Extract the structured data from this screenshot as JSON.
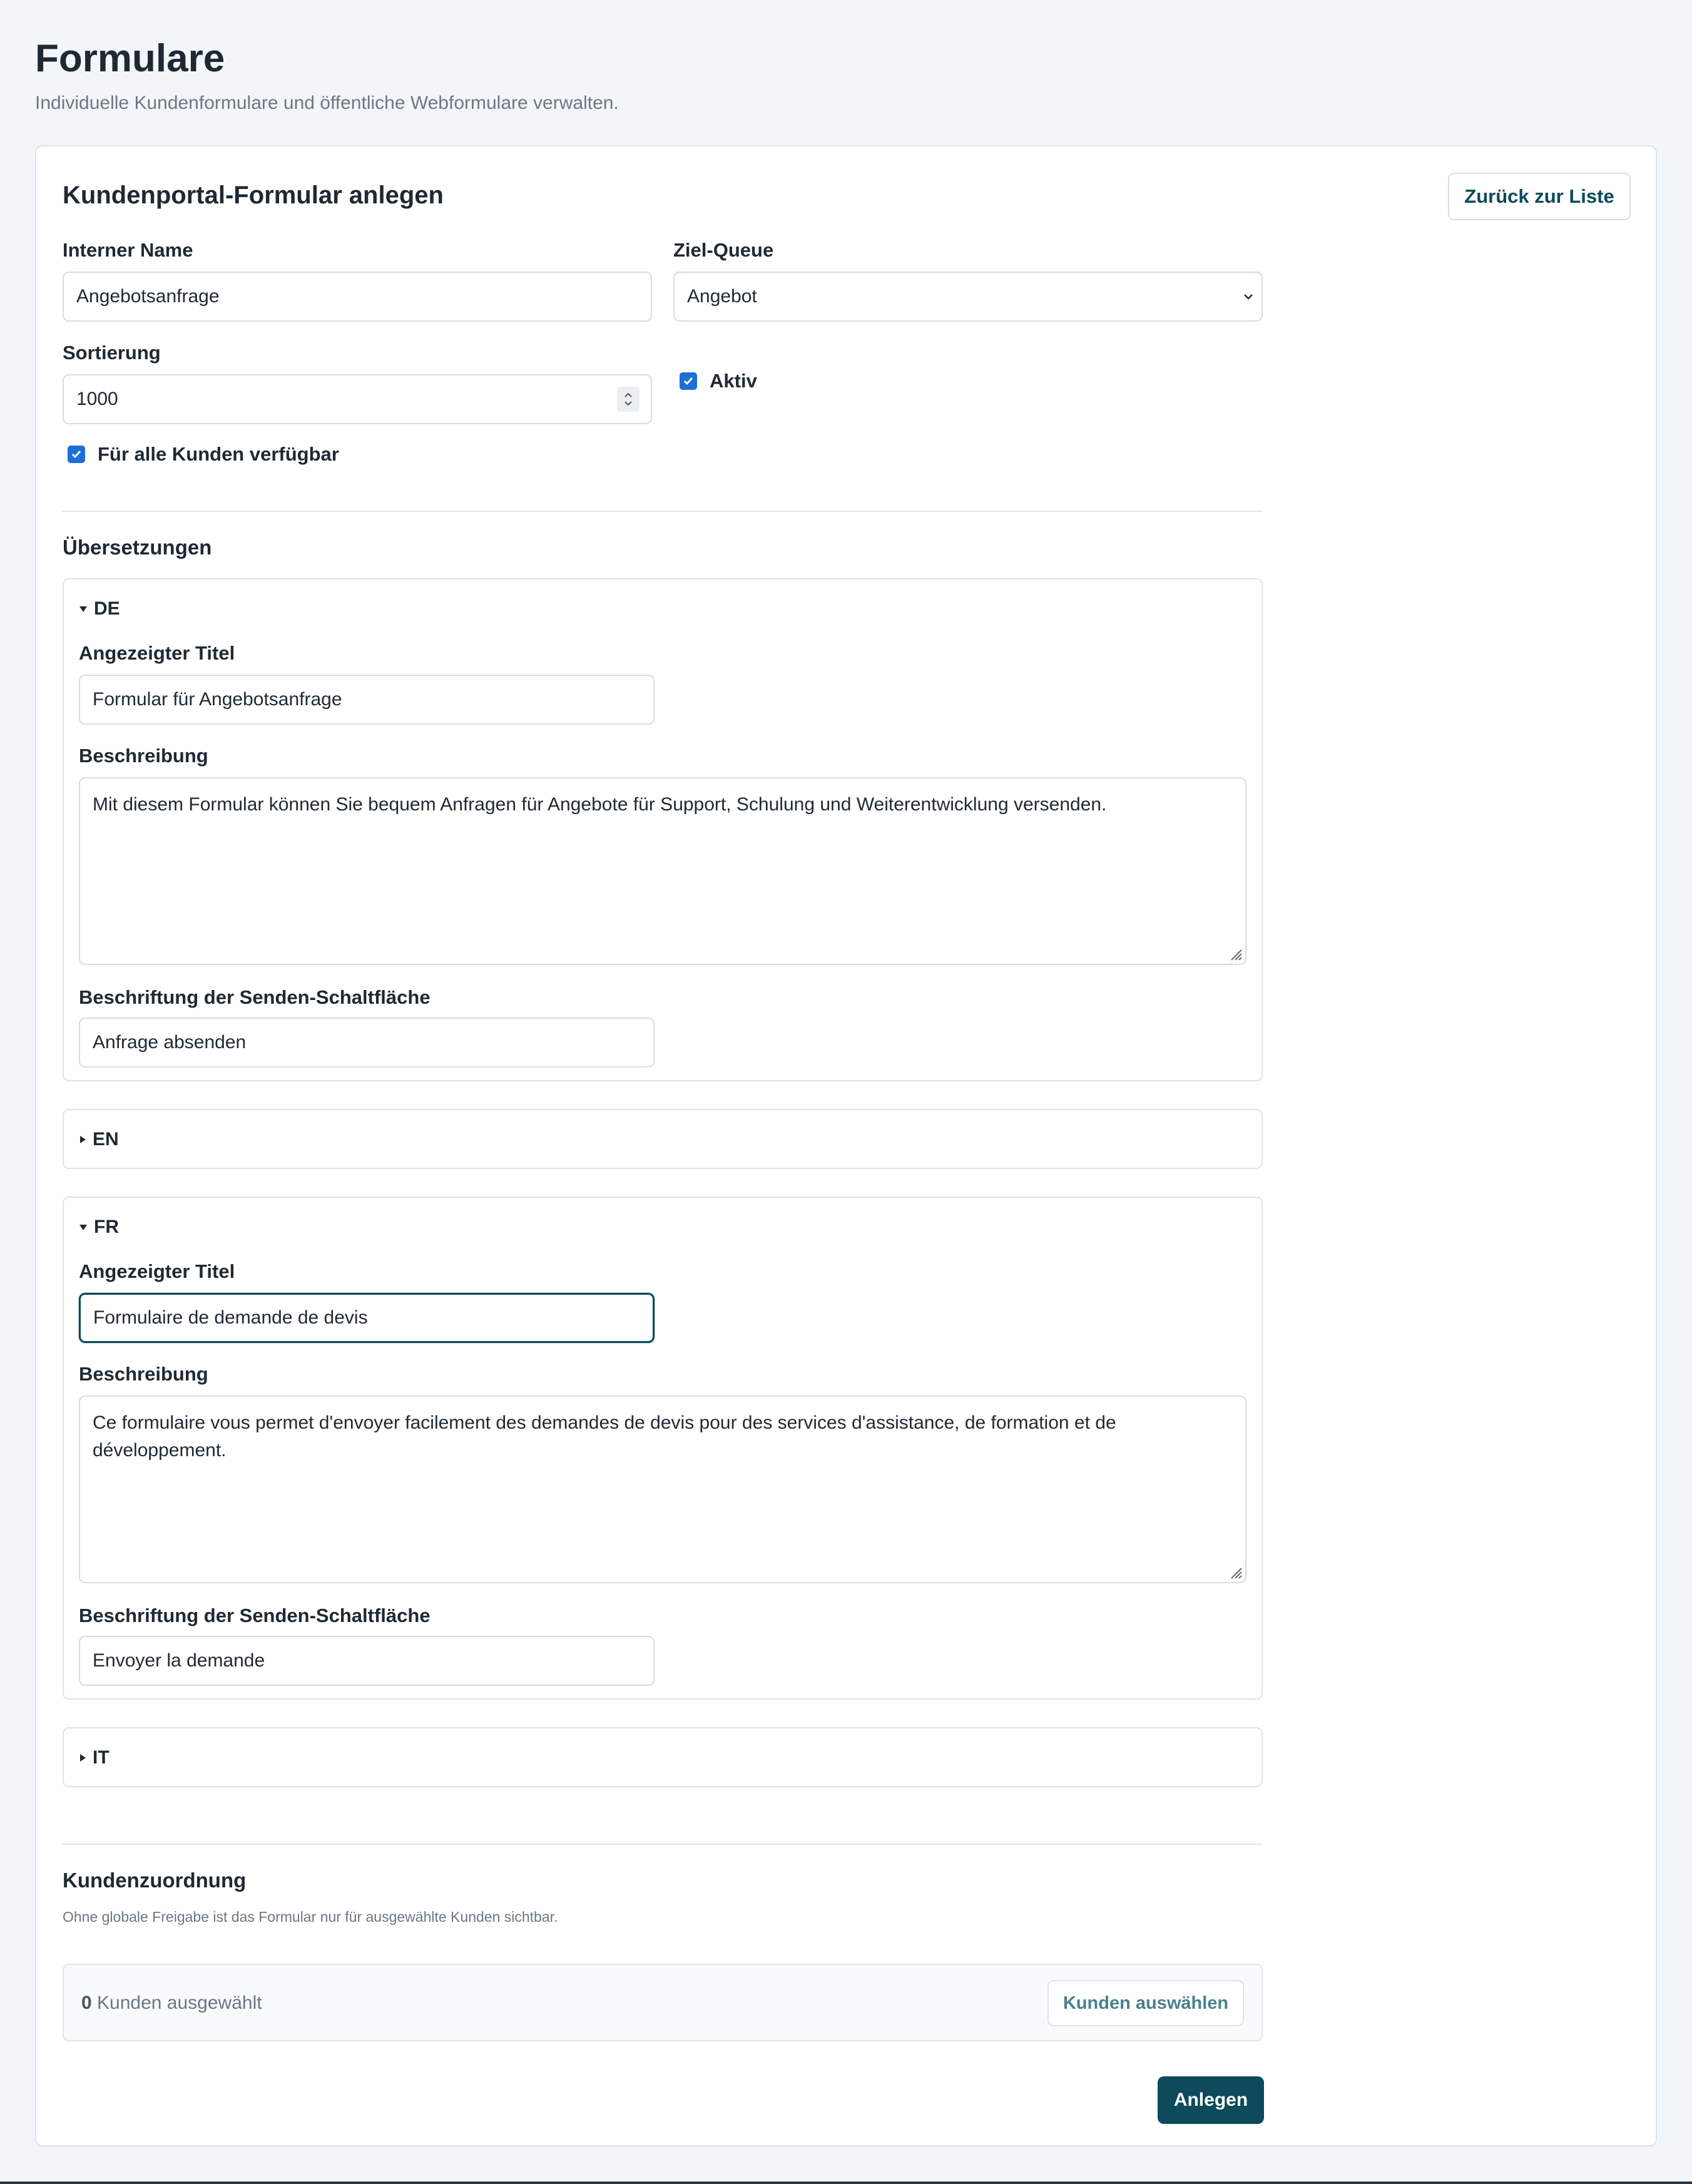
{
  "page": {
    "title": "Formulare",
    "subtitle": "Individuelle Kundenformulare und öffentliche Webformulare verwalten."
  },
  "form": {
    "title": "Kundenportal-Formular anlegen",
    "back_label": "Zurück zur Liste",
    "internal_name_label": "Interner Name",
    "internal_name_value": "Angebotsanfrage",
    "queue_label": "Ziel-Queue",
    "queue_value": "Angebot",
    "sort_label": "Sortierung",
    "sort_value": "1000",
    "active_label": "Aktiv",
    "active_checked": true,
    "all_customers_label": "Für alle Kunden verfügbar",
    "all_customers_checked": true
  },
  "translations": {
    "title": "Übersetzungen",
    "title_label": "Angezeigter Titel",
    "description_label": "Beschreibung",
    "submit_label_label": "Beschriftung der Senden-Schaltfläche",
    "languages": [
      {
        "code": "DE",
        "expanded": true,
        "title_value": "Formular für Angebotsanfrage",
        "description_value": "Mit diesem Formular können Sie bequem Anfragen für Angebote für Support, Schulung und Weiterentwicklung versenden.",
        "submit_value": "Anfrage absenden"
      },
      {
        "code": "EN",
        "expanded": false
      },
      {
        "code": "FR",
        "expanded": true,
        "title_value": "Formulaire de demande de devis",
        "description_value": "Ce formulaire vous permet d'envoyer facilement des demandes de devis pour des services d'assistance, de formation et de développement.",
        "submit_value": "Envoyer la demande"
      },
      {
        "code": "IT",
        "expanded": false
      }
    ]
  },
  "customers": {
    "title": "Kundenzuordnung",
    "help": "Ohne globale Freigabe ist das Formular nur für ausgewählte Kunden sichtbar.",
    "count": "0",
    "count_suffix": " Kunden ausgewählt",
    "select_label": "Kunden auswählen"
  },
  "actions": {
    "create_label": "Anlegen"
  },
  "icons": {
    "expanded": "caret-down-icon",
    "collapsed": "caret-right-icon",
    "checkbox": "checkmark-icon",
    "select": "chevron-down-icon"
  },
  "colors": {
    "primary": "#0c4a5c",
    "checkbox": "#1d6fd6",
    "background": "#f3f6f9"
  }
}
